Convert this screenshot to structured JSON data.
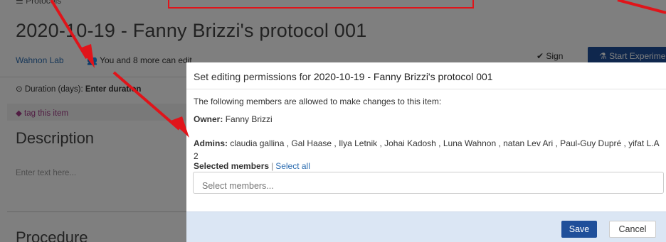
{
  "background": {
    "breadcrumb": "☰ Protocols",
    "title": "2020-10-19 - Fanny Brizzi's protocol 001",
    "lab_link": "Wahnon Lab",
    "edit_info": "You and 8 more can edit",
    "sign_label": "Sign",
    "start_label": "Start Experiment",
    "duration_label": "Duration (days):",
    "duration_value": "Enter duration",
    "tag_label": "tag this item",
    "description_heading": "Description",
    "description_placeholder": "Enter text here...",
    "procedure_heading": "Procedure"
  },
  "modal": {
    "title_prefix": "Set editing permissions for",
    "title_item": "2020-10-19 - Fanny Brizzi's protocol 001",
    "intro": "The following members are allowed to make changes to this item:",
    "owner_label": "Owner:",
    "owner_value": "Fanny Brizzi",
    "admins_label": "Admins:",
    "admins_value": "claudia gallina , Gal Haase , Ilya Letnik , Johai Kadosh , Luna Wahnon , natan Lev Ari , Paul-Guy Dupré , yifat L.A 2",
    "selected_label": "Selected members",
    "separator": "|",
    "select_all": "Select all",
    "members_placeholder": "Select members...",
    "save": "Save",
    "cancel": "Cancel"
  },
  "colors": {
    "annotation": "#e0141a",
    "primary": "#1f4f9a",
    "footer": "#dbe6f4",
    "link": "#2b6cb0"
  }
}
